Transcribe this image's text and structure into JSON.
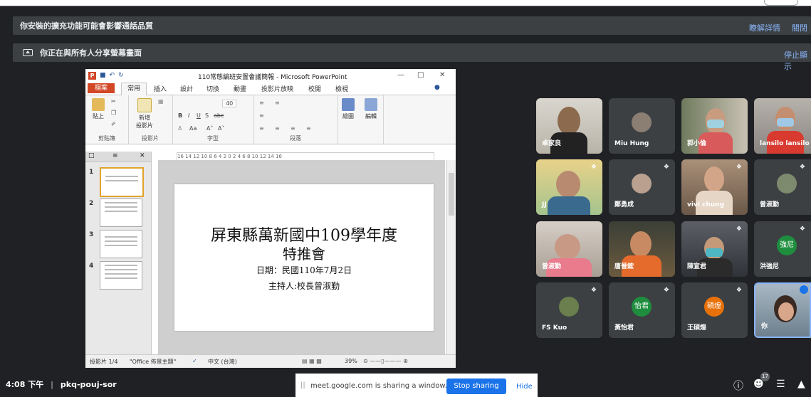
{
  "banner_ext": {
    "text": "你安裝的擴充功能可能會影響通話品質",
    "details": "瞭解詳情",
    "close": "關閉"
  },
  "banner_share": {
    "text": "你正在與所有人分享螢幕畫面",
    "stop": "停止顯示"
  },
  "ppt": {
    "logo": "P",
    "title": "110常態編班安置會議簡報 - Microsoft PowerPoint",
    "tabs": [
      "檔案",
      "常用",
      "插入",
      "設計",
      "切換",
      "動畫",
      "投影片放映",
      "校閱",
      "檢視"
    ],
    "ribbon": {
      "paste": "貼上",
      "new_slide": "新增\n投影片",
      "groups": [
        "剪貼簿",
        "投影片",
        "字型",
        "段落",
        "繪圖",
        "編輯"
      ],
      "font_size": "40",
      "draw": "繪圖",
      "edit": "編輯"
    },
    "ruler": "16 14 12 10 8 6 4 2 0 2 4 6 8 10 12 14 16",
    "slide": {
      "title1": "屏東縣萬新國中109學年度",
      "title2": "特推會",
      "date": "日期：民國110年7月2日",
      "host": "主持人:校長曾淑勤"
    },
    "thumbs": [
      "1",
      "2",
      "3",
      "4"
    ],
    "status": {
      "slide": "投影片 1/4",
      "theme": "\"Office 佈景主題\"",
      "lang": "中文 (台灣)",
      "zoom": "39%"
    }
  },
  "participants": [
    {
      "name": "卓家良"
    },
    {
      "name": "Miu Hung"
    },
    {
      "name": "郭小倫"
    },
    {
      "name": "lansilo lansilo"
    },
    {
      "name": "JJ"
    },
    {
      "name": "鄭勇成"
    },
    {
      "name": "vivi chung"
    },
    {
      "name": "曾淑勤"
    },
    {
      "name": "曾淑勤"
    },
    {
      "name": "唐晉鋐"
    },
    {
      "name": "陳宣君"
    },
    {
      "name": "洪強尼",
      "avatar": "強尼"
    },
    {
      "name": "FS Kuo"
    },
    {
      "name": "黃怡君",
      "avatar": "怡君"
    },
    {
      "name": "王碩煌",
      "avatar": "碩煌"
    },
    {
      "name": "你"
    }
  ],
  "bottom": {
    "time": "4:08 下午",
    "sep": "|",
    "code": "pkq-pouj-sor",
    "people_count": "17"
  },
  "share_notice": {
    "grip": "||",
    "msg": "meet.google.com is sharing a window.",
    "stop": "Stop sharing",
    "hide": "Hide"
  },
  "colors": {
    "bg": "#202124",
    "tile": "#3c4043",
    "accent": "#1a73e8",
    "link": "#8ab4f8",
    "ppt_red": "#d24726"
  }
}
